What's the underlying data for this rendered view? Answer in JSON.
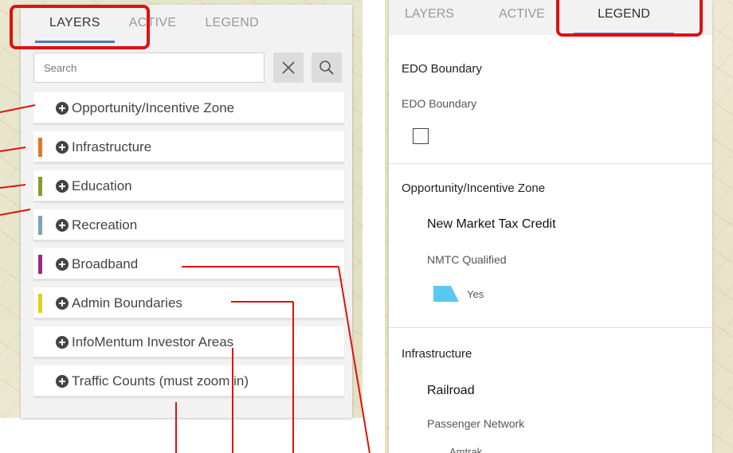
{
  "left_panel": {
    "tabs": [
      "LAYERS",
      "ACTIVE",
      "LEGEND"
    ],
    "active_tab": 0,
    "search": {
      "placeholder": "Search"
    },
    "layers": [
      {
        "label": "Opportunity/Incentive Zone",
        "swatch": null
      },
      {
        "label": "Infrastructure",
        "swatch": "#e2762c"
      },
      {
        "label": "Education",
        "swatch": "#8a9a2a"
      },
      {
        "label": "Recreation",
        "swatch": "#7aa6b0"
      },
      {
        "label": "Broadband",
        "swatch": "#9b2a8a"
      },
      {
        "label": "Admin Boundaries",
        "swatch": "#d6d31f"
      },
      {
        "label": "InfoMentum Investor Areas",
        "swatch": null
      },
      {
        "label": "Traffic Counts (must zoom in)",
        "swatch": null
      }
    ]
  },
  "right_panel": {
    "tabs": [
      "LAYERS",
      "ACTIVE",
      "LEGEND"
    ],
    "active_tab": 2,
    "sections": [
      {
        "title": "EDO Boundary",
        "subtitle": "EDO Boundary"
      },
      {
        "title": "Opportunity/Incentive Zone",
        "layer": "New Market Tax Credit",
        "field": "NMTC Qualified",
        "value": "Yes",
        "symbol_color": "#5bc8f2"
      },
      {
        "title": "Infrastructure",
        "layer": "Railroad",
        "field": "Passenger Network",
        "value": "Amtrak"
      }
    ]
  },
  "annotation_color": "#e01010"
}
